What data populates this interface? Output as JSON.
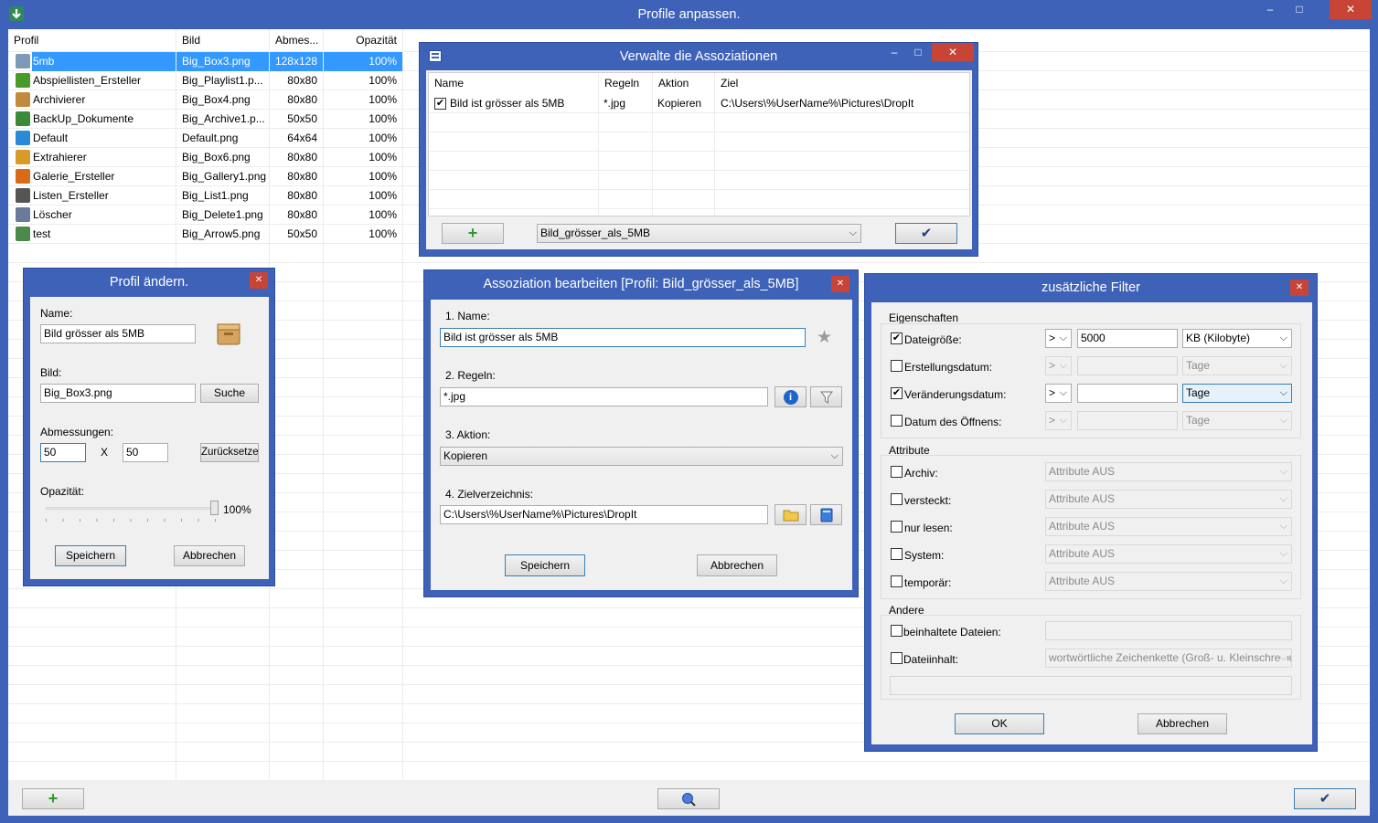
{
  "main": {
    "title": "Profile anpassen.",
    "columns": [
      "Profil",
      "Bild",
      "Abmes...",
      "Opazität"
    ],
    "rows": [
      {
        "profile": "5mb",
        "image": "Big_Box3.png",
        "size": "128x128",
        "opacity": "100%",
        "icon": "disk-icon",
        "color": "#7f9ab8"
      },
      {
        "profile": "Abspiellisten_Ersteller",
        "image": "Big_Playlist1.p...",
        "size": "80x80",
        "opacity": "100%",
        "icon": "music-note-icon",
        "color": "#4a9a2a"
      },
      {
        "profile": "Archivierer",
        "image": "Big_Box4.png",
        "size": "80x80",
        "opacity": "100%",
        "icon": "box-icon",
        "color": "#c28a3c"
      },
      {
        "profile": "BackUp_Dokumente",
        "image": "Big_Archive1.p...",
        "size": "50x50",
        "opacity": "100%",
        "icon": "archive-icon",
        "color": "#3a8a3a"
      },
      {
        "profile": "Default",
        "image": "Default.png",
        "size": "64x64",
        "opacity": "100%",
        "icon": "download-arrow-icon",
        "color": "#2a8ad8"
      },
      {
        "profile": "Extrahierer",
        "image": "Big_Box6.png",
        "size": "80x80",
        "opacity": "100%",
        "icon": "open-box-icon",
        "color": "#d89a2a"
      },
      {
        "profile": "Galerie_Ersteller",
        "image": "Big_Gallery1.png",
        "size": "80x80",
        "opacity": "100%",
        "icon": "gallery-icon",
        "color": "#d86a1a"
      },
      {
        "profile": "Listen_Ersteller",
        "image": "Big_List1.png",
        "size": "80x80",
        "opacity": "100%",
        "icon": "list-icon",
        "color": "#555555"
      },
      {
        "profile": "Löscher",
        "image": "Big_Delete1.png",
        "size": "80x80",
        "opacity": "100%",
        "icon": "trash-icon",
        "color": "#6a7a9a"
      },
      {
        "profile": "test",
        "image": "Big_Arrow5.png",
        "size": "50x50",
        "opacity": "100%",
        "icon": "arrow-icon",
        "color": "#4a8a4a"
      }
    ]
  },
  "assoc_list": {
    "title": "Verwalte die Assoziationen",
    "columns": [
      "Name",
      "Regeln",
      "Aktion",
      "Ziel"
    ],
    "rows": [
      {
        "name": "Bild ist grösser als 5MB",
        "rules": "*.jpg",
        "action": "Kopieren",
        "target": "C:\\Users\\%UserName%\\Pictures\\DropIt",
        "checked": true
      }
    ],
    "profile_select": "Bild_grösser_als_5MB"
  },
  "profile_edit": {
    "title": "Profil ändern.",
    "name_label": "Name:",
    "name_value": "Bild grösser als 5MB",
    "image_label": "Bild:",
    "image_value": "Big_Box3.png",
    "search_button": "Suche",
    "size_label": "Abmessungen:",
    "width_value": "50",
    "height_value": "50",
    "x_label": "X",
    "reset_button": "Zurücksetzen",
    "opacity_label": "Opazität:",
    "opacity_value": "100%",
    "save_button": "Speichern",
    "cancel_button": "Abbrechen"
  },
  "assoc_edit": {
    "title": "Assoziation bearbeiten [Profil: Bild_grösser_als_5MB]",
    "name_label": "1. Name:",
    "name_value": "Bild ist grösser als 5MB",
    "rules_label": "2. Regeln:",
    "rules_value": "*.jpg",
    "action_label": "3. Aktion:",
    "action_value": "Kopieren",
    "target_label": "4. Zielverzeichnis:",
    "target_value": "C:\\Users\\%UserName%\\Pictures\\DropIt",
    "save_button": "Speichern",
    "cancel_button": "Abbrechen"
  },
  "filters": {
    "title": "zusätzliche Filter",
    "properties_label": "Eigenschaften",
    "properties": [
      {
        "label": "Dateigröße:",
        "checked": true,
        "op": ">",
        "value": "5000",
        "unit": "KB (Kilobyte)",
        "enabled": true
      },
      {
        "label": "Erstellungsdatum:",
        "checked": false,
        "op": ">",
        "value": "",
        "unit": "Tage",
        "enabled": false
      },
      {
        "label": "Veränderungsdatum:",
        "checked": true,
        "op": ">",
        "value": "",
        "unit": "Tage",
        "enabled": true
      },
      {
        "label": "Datum des Öffnens:",
        "checked": false,
        "op": ">",
        "value": "",
        "unit": "Tage",
        "enabled": false
      }
    ],
    "attributes_label": "Attribute",
    "attributes": [
      {
        "label": "Archiv:",
        "value": "Attribute AUS"
      },
      {
        "label": "versteckt:",
        "value": "Attribute AUS"
      },
      {
        "label": "nur lesen:",
        "value": "Attribute AUS"
      },
      {
        "label": "System:",
        "value": "Attribute AUS"
      },
      {
        "label": "temporär:",
        "value": "Attribute AUS"
      }
    ],
    "other_label": "Andere",
    "contained_files_label": "beinhaltete Dateien:",
    "file_content_label": "Dateiinhalt:",
    "file_content_mode": "wortwörtliche Zeichenkette (Groß- u. Kleinschreibung",
    "ok_button": "OK",
    "cancel_button": "Abbrechen"
  }
}
